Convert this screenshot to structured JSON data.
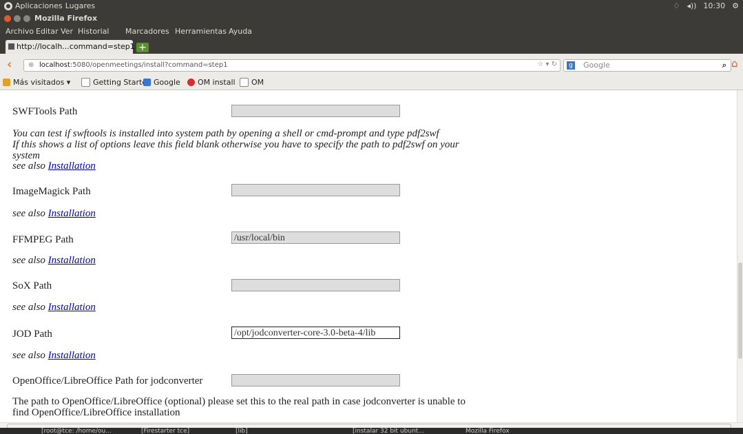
{
  "top_panel": {
    "menus": [
      "Aplicaciones",
      "Lugares"
    ],
    "time": "10:30"
  },
  "window": {
    "title": "Mozilla Firefox"
  },
  "menubar": {
    "items": [
      "Archivo",
      "Editar",
      "Ver",
      "Historial",
      "Marcadores",
      "Herramientas",
      "Ayuda"
    ]
  },
  "tab": {
    "label": "http://localh...command=step1"
  },
  "nav": {
    "url_host": "localhost",
    "url_rest": ":5080/openmeetings/install?command=step1",
    "search_placeholder": "Google"
  },
  "bookmarks": [
    {
      "label": "Más visitados ▾",
      "icon": "folder-icon"
    },
    {
      "label": "Getting Started",
      "icon": "page-icon"
    },
    {
      "label": "Google",
      "icon": "google-icon"
    },
    {
      "label": "OM install",
      "icon": "om-icon"
    },
    {
      "label": "OM",
      "icon": "page-icon"
    }
  ],
  "form": {
    "swftools_label": "SWFTools Path",
    "swftools_value": "",
    "swftools_note_1": "You can test if swftools is installed into system path by opening a shell or cmd-prompt and type pdf2swf",
    "swftools_note_2": "If this shows a list of options leave this field blank otherwise you have to specify the path to pdf2swf on your",
    "swftools_note_3": "system",
    "see_also": "see also",
    "link": "Installation",
    "imagemagick_label": "ImageMagick Path",
    "imagemagick_value": "",
    "ffmpeg_label": "FFMPEG Path",
    "ffmpeg_value": "/usr/local/bin",
    "sox_label": "SoX Path",
    "sox_value": "",
    "jod_label": "JOD Path",
    "jod_value": "/opt/jodconverter-core-3.0-beta-4/lib",
    "office_label": "OpenOffice/LibreOffice Path for jodconverter",
    "office_value": "",
    "office_note_1": "The path to OpenOffice/LibreOffice (optional) please set this to the real path in case jodconverter is unable to",
    "office_note_2": "find OpenOffice/LibreOffice installation"
  },
  "taskbar": [
    "[root@tce: /home/ou...",
    "[Firestarter tce]",
    "[lib]",
    "[instalar 32 bit ubunt...",
    "Mozilla Firefox"
  ]
}
